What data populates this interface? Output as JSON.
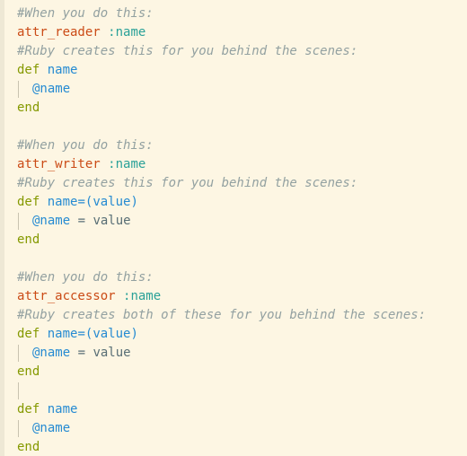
{
  "code": {
    "l1": "#When you do this:",
    "l2_method": "attr_reader",
    "l2_symbol": ":name",
    "l3": "#Ruby creates this for you behind the scenes:",
    "l4_kw": "def",
    "l4_name": "name",
    "l5_ivar": "@name",
    "l6_end": "end",
    "l8": "#When you do this:",
    "l9_method": "attr_writer",
    "l9_symbol": ":name",
    "l10": "#Ruby creates this for you behind the scenes:",
    "l11_kw": "def",
    "l11_name": "name=",
    "l11_open": "(",
    "l11_param": "value",
    "l11_close": ")",
    "l12_ivar": "@name",
    "l12_op": " = ",
    "l12_val": "value",
    "l13_end": "end",
    "l15": "#When you do this:",
    "l16_method": "attr_accessor",
    "l16_symbol": ":name",
    "l17": "#Ruby creates both of these for you behind the scenes:",
    "l18_kw": "def",
    "l18_name": "name=",
    "l18_open": "(",
    "l18_param": "value",
    "l18_close": ")",
    "l19_ivar": "@name",
    "l19_op": " = ",
    "l19_val": "value",
    "l20_end": "end",
    "l22_kw": "def",
    "l22_name": "name",
    "l23_ivar": "@name",
    "l24_end": "end"
  },
  "colors": {
    "background": "#fdf6e3",
    "comment": "#93a1a1",
    "method": "#cb4b16",
    "symbol": "#2aa198",
    "keyword": "#859900",
    "identifier": "#268bd2"
  }
}
